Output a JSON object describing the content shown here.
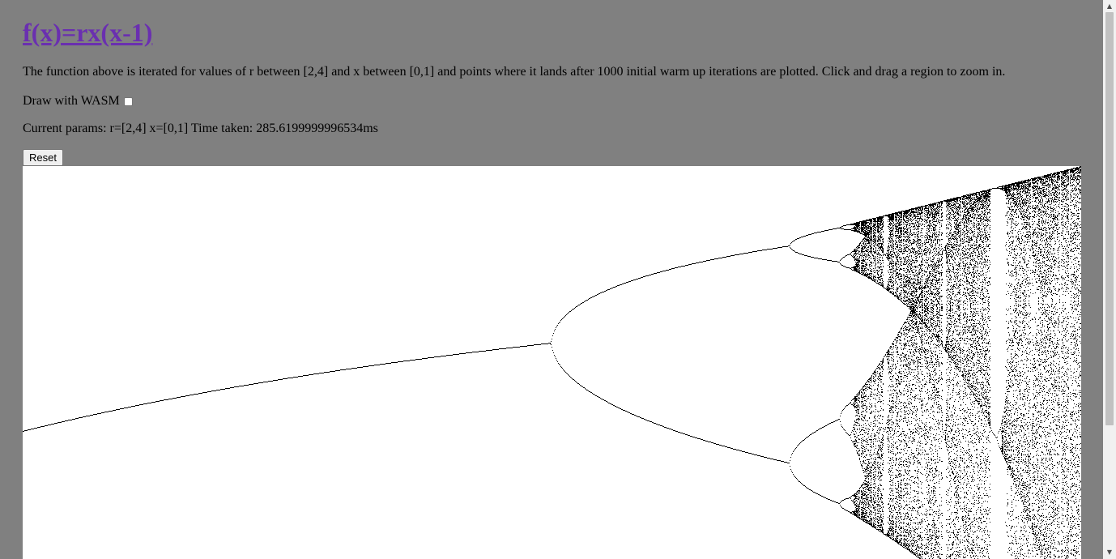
{
  "heading": "f(x)=rx(x-1)",
  "description": "The function above is iterated for values of r between [2,4] and x between [0,1] and points where it lands after 1000 initial warm up iterations are plotted. Click and drag a region to zoom in.",
  "wasm_label": "Draw with WASM",
  "wasm_checked": false,
  "params_text": "Current params: r=[2,4] x=[0,1] Time taken: 285.6199999996534ms",
  "reset_label": "Reset",
  "plot_params": {
    "r_range": [
      2,
      4
    ],
    "x_range": [
      0,
      1
    ],
    "warmup_iterations": 1000
  },
  "colors": {
    "page_background": "#808080",
    "link": "#6a2fb0",
    "plot_background": "#ffffff",
    "points": "#000000"
  },
  "icons": {
    "scroll_up": "triangle-up-icon",
    "scroll_down": "triangle-down-icon"
  }
}
